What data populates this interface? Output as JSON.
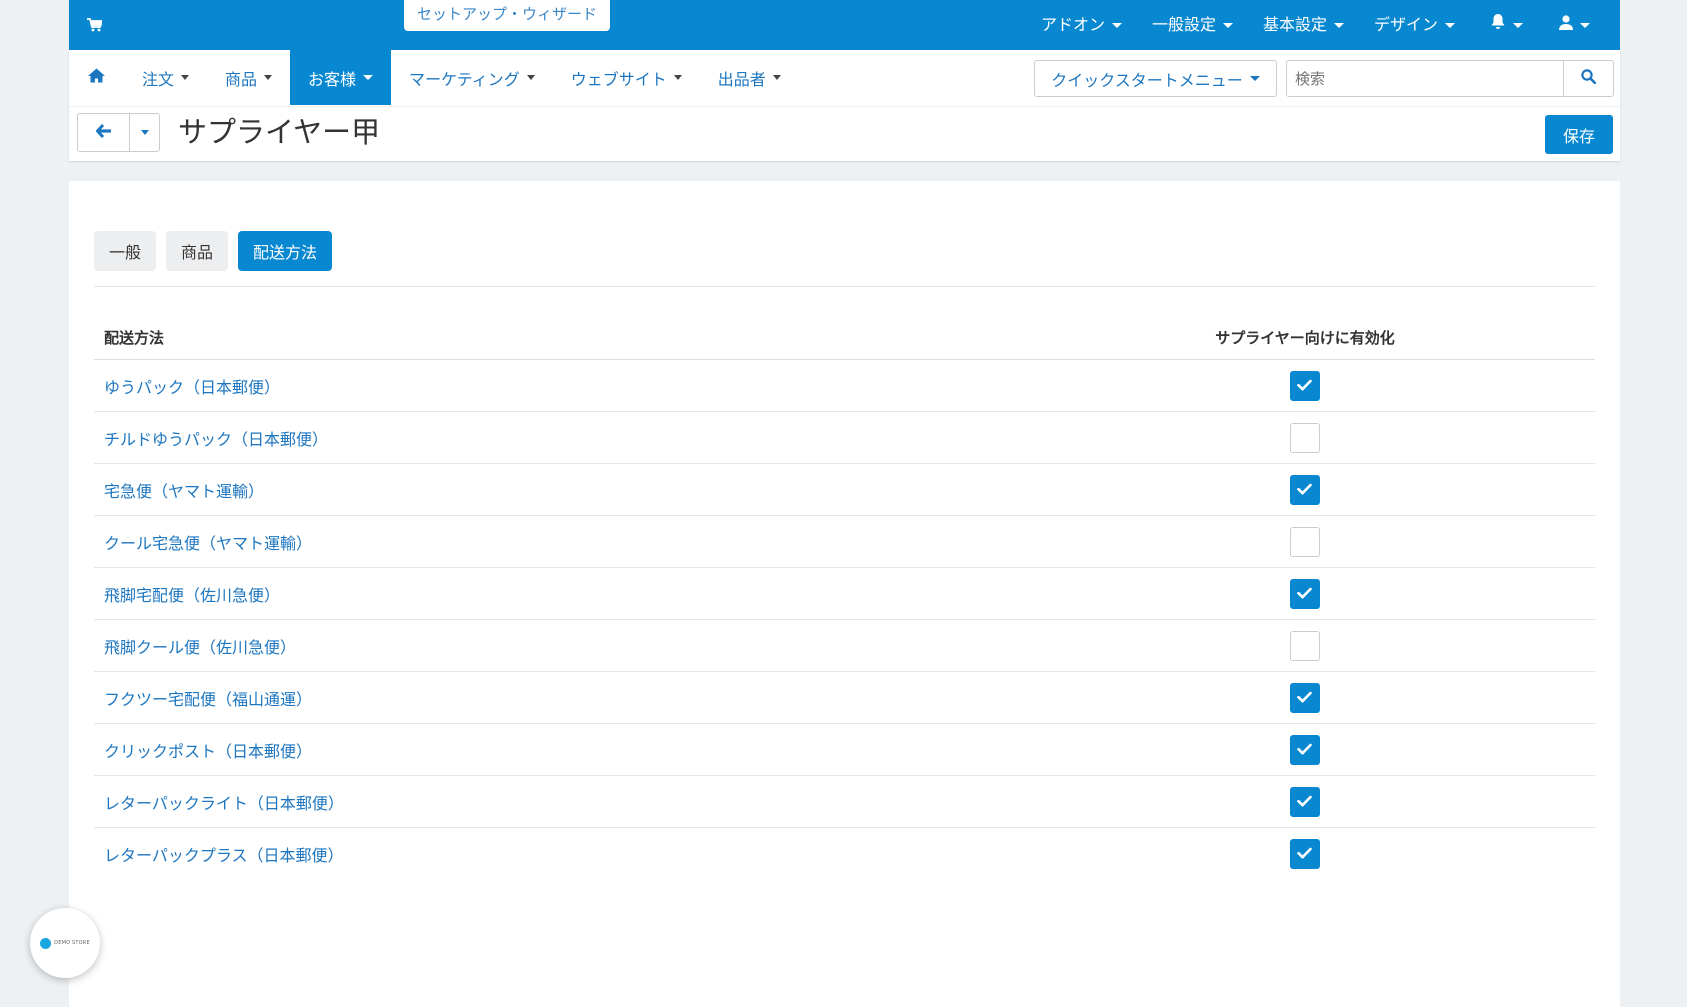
{
  "topbar": {
    "wizard_label": "セットアップ・ウィザード",
    "menu": [
      "アドオン",
      "一般設定",
      "基本設定",
      "デザイン"
    ]
  },
  "mainnav": {
    "items": [
      "注文",
      "商品",
      "お客様",
      "マーケティング",
      "ウェブサイト",
      "出品者"
    ],
    "active": "お客様"
  },
  "quickstart_label": "クイックスタートメニュー",
  "search": {
    "placeholder": "検索",
    "value": ""
  },
  "page_title": "サプライヤー甲",
  "save_label": "保存",
  "tabs": [
    "一般",
    "商品",
    "配送方法"
  ],
  "active_tab": "配送方法",
  "table": {
    "headers": {
      "method": "配送方法",
      "enabled": "サプライヤー向けに有効化"
    },
    "rows": [
      {
        "name": "ゆうパック（日本郵便）",
        "enabled": true
      },
      {
        "name": "チルドゆうパック（日本郵便）",
        "enabled": false
      },
      {
        "name": "宅急便（ヤマト運輸）",
        "enabled": true
      },
      {
        "name": "クール宅急便（ヤマト運輸）",
        "enabled": false
      },
      {
        "name": "飛脚宅配便（佐川急便）",
        "enabled": true
      },
      {
        "name": "飛脚クール便（佐川急便）",
        "enabled": false
      },
      {
        "name": "フクツー宅配便（福山通運）",
        "enabled": true
      },
      {
        "name": "クリックポスト（日本郵便）",
        "enabled": true
      },
      {
        "name": "レターパックライト（日本郵便）",
        "enabled": true
      },
      {
        "name": "レターパックプラス（日本郵便）",
        "enabled": true
      }
    ]
  },
  "badge_text": "DEMO STORE",
  "colors": {
    "primary": "#0988d2",
    "link": "#1d76c0",
    "background": "#eef1f4"
  },
  "icons": [
    "cart-icon",
    "home-icon",
    "bell-icon",
    "user-icon",
    "search-icon",
    "arrow-left-icon",
    "check-icon"
  ]
}
